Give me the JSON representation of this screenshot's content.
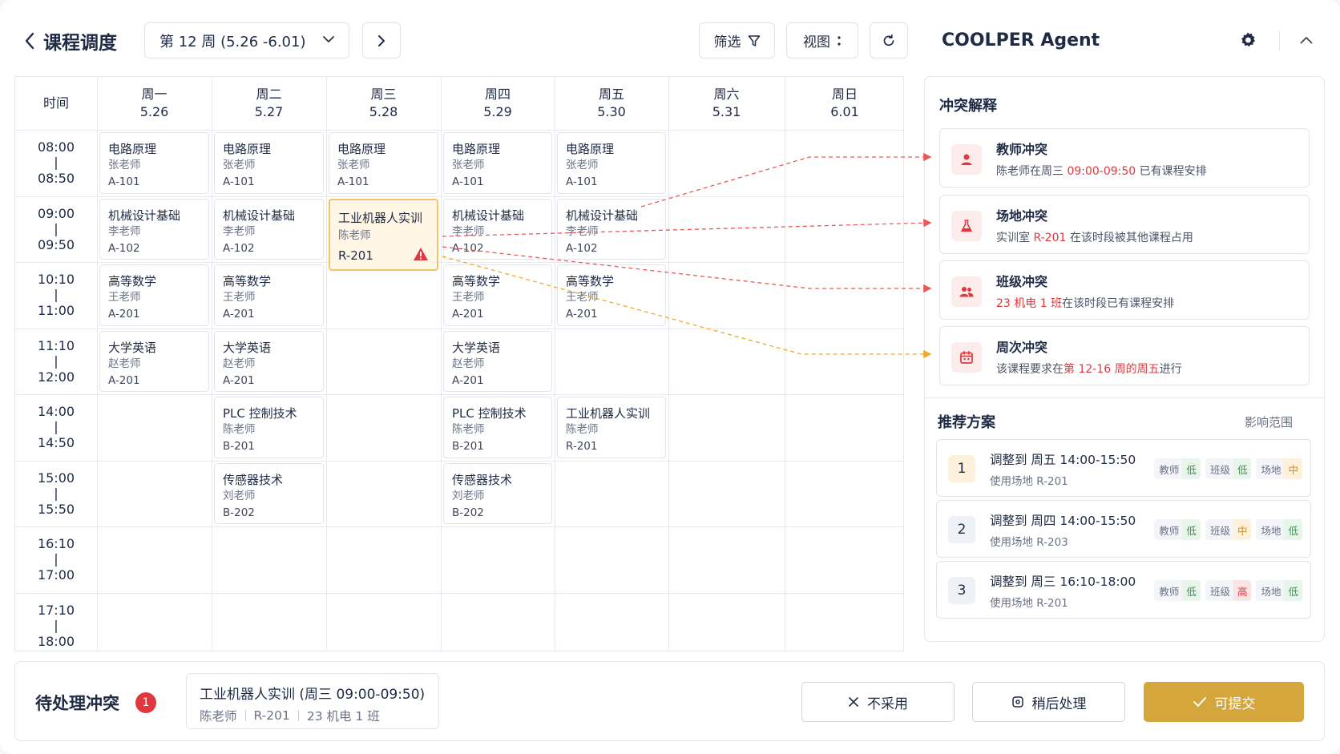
{
  "header": {
    "title": "课程调度",
    "week": "第 12 周 (5.26 -6.01)",
    "filter_label": "筛选",
    "view_label": "视图"
  },
  "timetable": {
    "time_header": "时间",
    "days": [
      {
        "name": "周一",
        "date": "5.26"
      },
      {
        "name": "周二",
        "date": "5.27"
      },
      {
        "name": "周三",
        "date": "5.28"
      },
      {
        "name": "周四",
        "date": "5.29"
      },
      {
        "name": "周五",
        "date": "5.30"
      },
      {
        "name": "周六",
        "date": "5.31"
      },
      {
        "name": "周日",
        "date": "6.01"
      }
    ],
    "slots": [
      {
        "start": "08:00",
        "sep": "|",
        "end": "08:50"
      },
      {
        "start": "09:00",
        "sep": "|",
        "end": "09:50"
      },
      {
        "start": "10:10",
        "sep": "|",
        "end": "11:00"
      },
      {
        "start": "11:10",
        "sep": "|",
        "end": "12:00"
      },
      {
        "start": "14:00",
        "sep": "|",
        "end": "14:50"
      },
      {
        "start": "15:00",
        "sep": "|",
        "end": "15:50"
      },
      {
        "start": "16:10",
        "sep": "|",
        "end": "17:00"
      },
      {
        "start": "17:10",
        "sep": "|",
        "end": "18:00"
      }
    ],
    "courses": [
      {
        "day": 0,
        "slot": 0,
        "name": "电路原理",
        "teacher": "张老师",
        "room": "A-101"
      },
      {
        "day": 1,
        "slot": 0,
        "name": "电路原理",
        "teacher": "张老师",
        "room": "A-101"
      },
      {
        "day": 2,
        "slot": 0,
        "name": "电路原理",
        "teacher": "张老师",
        "room": "A-101"
      },
      {
        "day": 3,
        "slot": 0,
        "name": "电路原理",
        "teacher": "张老师",
        "room": "A-101"
      },
      {
        "day": 4,
        "slot": 0,
        "name": "电路原理",
        "teacher": "张老师",
        "room": "A-101"
      },
      {
        "day": 0,
        "slot": 1,
        "name": "机械设计基础",
        "teacher": "李老师",
        "room": "A-102"
      },
      {
        "day": 1,
        "slot": 1,
        "name": "机械设计基础",
        "teacher": "李老师",
        "room": "A-102"
      },
      {
        "day": 2,
        "slot": 1,
        "name": "工业机器人实训",
        "teacher": "陈老师",
        "room": "R-201",
        "conflict": true
      },
      {
        "day": 3,
        "slot": 1,
        "name": "机械设计基础",
        "teacher": "李老师",
        "room": "A-102"
      },
      {
        "day": 4,
        "slot": 1,
        "name": "机械设计基础",
        "teacher": "李老师",
        "room": "A-102"
      },
      {
        "day": 0,
        "slot": 2,
        "name": "高等数学",
        "teacher": "王老师",
        "room": "A-201"
      },
      {
        "day": 1,
        "slot": 2,
        "name": "高等数学",
        "teacher": "王老师",
        "room": "A-201"
      },
      {
        "day": 3,
        "slot": 2,
        "name": "高等数学",
        "teacher": "王老师",
        "room": "A-201"
      },
      {
        "day": 4,
        "slot": 2,
        "name": "高等数学",
        "teacher": "王老师",
        "room": "A-201"
      },
      {
        "day": 0,
        "slot": 3,
        "name": "大学英语",
        "teacher": "赵老师",
        "room": "A-201"
      },
      {
        "day": 1,
        "slot": 3,
        "name": "大学英语",
        "teacher": "赵老师",
        "room": "A-201"
      },
      {
        "day": 3,
        "slot": 3,
        "name": "大学英语",
        "teacher": "赵老师",
        "room": "A-201"
      },
      {
        "day": 1,
        "slot": 4,
        "name": "PLC 控制技术",
        "teacher": "陈老师",
        "room": "B-201"
      },
      {
        "day": 3,
        "slot": 4,
        "name": "PLC 控制技术",
        "teacher": "陈老师",
        "room": "B-201"
      },
      {
        "day": 4,
        "slot": 4,
        "name": "工业机器人实训",
        "teacher": "陈老师",
        "room": "R-201"
      },
      {
        "day": 1,
        "slot": 5,
        "name": "传感器技术",
        "teacher": "刘老师",
        "room": "B-202"
      },
      {
        "day": 3,
        "slot": 5,
        "name": "传感器技术",
        "teacher": "刘老师",
        "room": "B-202"
      }
    ]
  },
  "agent": {
    "title": "COOLPER Agent",
    "conflict_title": "冲突解释",
    "conflicts": [
      {
        "title": "教师冲突",
        "pre": "陈老师在周三 ",
        "hl": "09:00-09:50",
        "post": " 已有课程安排",
        "icon": "person-icon"
      },
      {
        "title": "场地冲突",
        "pre": "实训室 ",
        "hl": "R-201",
        "post": " 在该时段被其他课程占用",
        "icon": "flask-icon"
      },
      {
        "title": "班级冲突",
        "pre": "",
        "hl": "23 机电 1 班",
        "post": "在该时段已有课程安排",
        "icon": "group-icon"
      },
      {
        "title": "周次冲突",
        "pre": "该课程要求在",
        "hl": "第 12-16 周的周五",
        "post": "进行",
        "icon": "calendar-icon"
      }
    ],
    "rec_title": "推荐方案",
    "impact_label": "影响范围",
    "recommendations": [
      {
        "num": "1",
        "title": "调整到 周五 14:00-15:50",
        "sub": "使用场地 R-201",
        "teacher_lv": "低",
        "class_lv": "低",
        "room_lv": "中"
      },
      {
        "num": "2",
        "title": "调整到 周四 14:00-15:50",
        "sub": "使用场地 R-203",
        "teacher_lv": "低",
        "class_lv": "中",
        "room_lv": "低"
      },
      {
        "num": "3",
        "title": "调整到 周三 16:10-18:00",
        "sub": "使用场地 R-201",
        "teacher_lv": "低",
        "class_lv": "高",
        "room_lv": "低"
      }
    ],
    "tag_labels": {
      "teacher": "教师",
      "class": "班级",
      "room": "场地"
    }
  },
  "pending": {
    "title": "待处理冲突",
    "count": "1",
    "course": "工业机器人实训 (周三 09:00-09:50)",
    "teacher": "陈老师",
    "room": "R-201",
    "class": "23 机电 1 班",
    "reject_label": "不采用",
    "later_label": "稍后处理",
    "submit_label": "可提交"
  },
  "colors": {
    "accent": "#d4a63c",
    "conflict_red": "#e0383e",
    "warning_orange": "#f0a82c",
    "highlight_bg": "#fff6e6"
  }
}
